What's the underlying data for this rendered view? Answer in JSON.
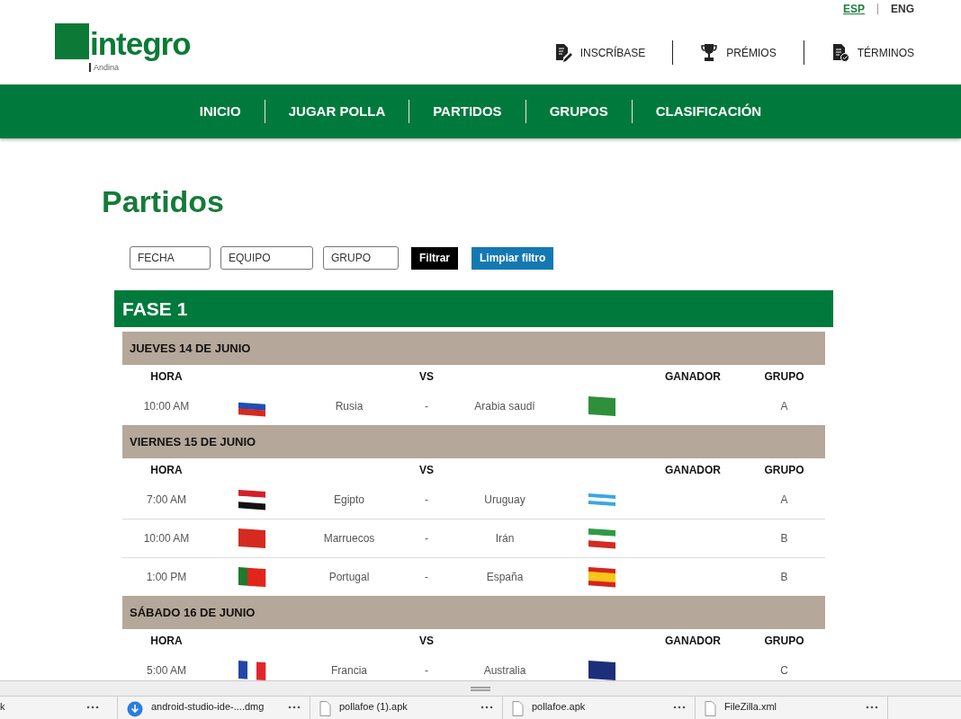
{
  "languages": [
    {
      "label": "ESP",
      "selected": true
    },
    {
      "label": "ENG",
      "selected": false
    }
  ],
  "logo": {
    "name": "integro",
    "tagline": "Andina"
  },
  "top_links": [
    {
      "label": "INSCRÍBASE",
      "kind": "signup"
    },
    {
      "label": "PRÉMIOS",
      "kind": "prizes"
    },
    {
      "label": "TÉRMINOS",
      "kind": "terms"
    }
  ],
  "nav": [
    "INICIO",
    "JUGAR POLLA",
    "PARTIDOS",
    "GRUPOS",
    "CLASIFICACIÓN"
  ],
  "page_title": "Partidos",
  "filters": [
    {
      "placeholder": "FECHA"
    },
    {
      "placeholder": "EQUIPO"
    },
    {
      "placeholder": "GRUPO"
    }
  ],
  "buttons": [
    {
      "label": "Filtrar",
      "kind": "dark"
    },
    {
      "label": "Limpiar filtro",
      "kind": "blue"
    }
  ],
  "phase": "FASE 1",
  "days": [
    {
      "date": "JUEVES 14 DE JUNIO",
      "columns": [
        "HORA",
        "VS",
        "GANADOR",
        "GRUPO"
      ],
      "matches": [
        {
          "time": "10:00 AM",
          "home": "Rusia",
          "sep": "-",
          "away": "Arabia saudí",
          "group": "A"
        }
      ]
    },
    {
      "date": "VIERNES 15 DE JUNIO",
      "columns": [
        "HORA",
        "VS",
        "GANADOR",
        "GRUPO"
      ],
      "matches": [
        {
          "time": "7:00 AM",
          "home": "Egipto",
          "sep": "-",
          "away": "Uruguay",
          "group": "A"
        },
        {
          "time": "10:00 AM",
          "home": "Marruecos",
          "sep": "-",
          "away": "Irán",
          "group": "B"
        },
        {
          "time": "1:00 PM",
          "home": "Portugal",
          "sep": "-",
          "away": "España",
          "group": "B"
        }
      ]
    },
    {
      "date": "SÁBADO 16 DE JUNIO",
      "columns": [
        "HORA",
        "VS",
        "GANADOR",
        "GRUPO"
      ],
      "matches": [
        {
          "time": "5:00 AM",
          "home": "Francia",
          "sep": "-",
          "away": "Australia",
          "group": "C"
        }
      ]
    }
  ],
  "downloads": [
    {
      "name": "k"
    },
    {
      "name": "android-studio-ide-....dmg",
      "kind": "downloading"
    },
    {
      "name": "pollafoe (1).apk",
      "kind": "file"
    },
    {
      "name": "pollafoe.apk",
      "kind": "file"
    },
    {
      "name": "FileZilla.xml",
      "kind": "file"
    }
  ]
}
